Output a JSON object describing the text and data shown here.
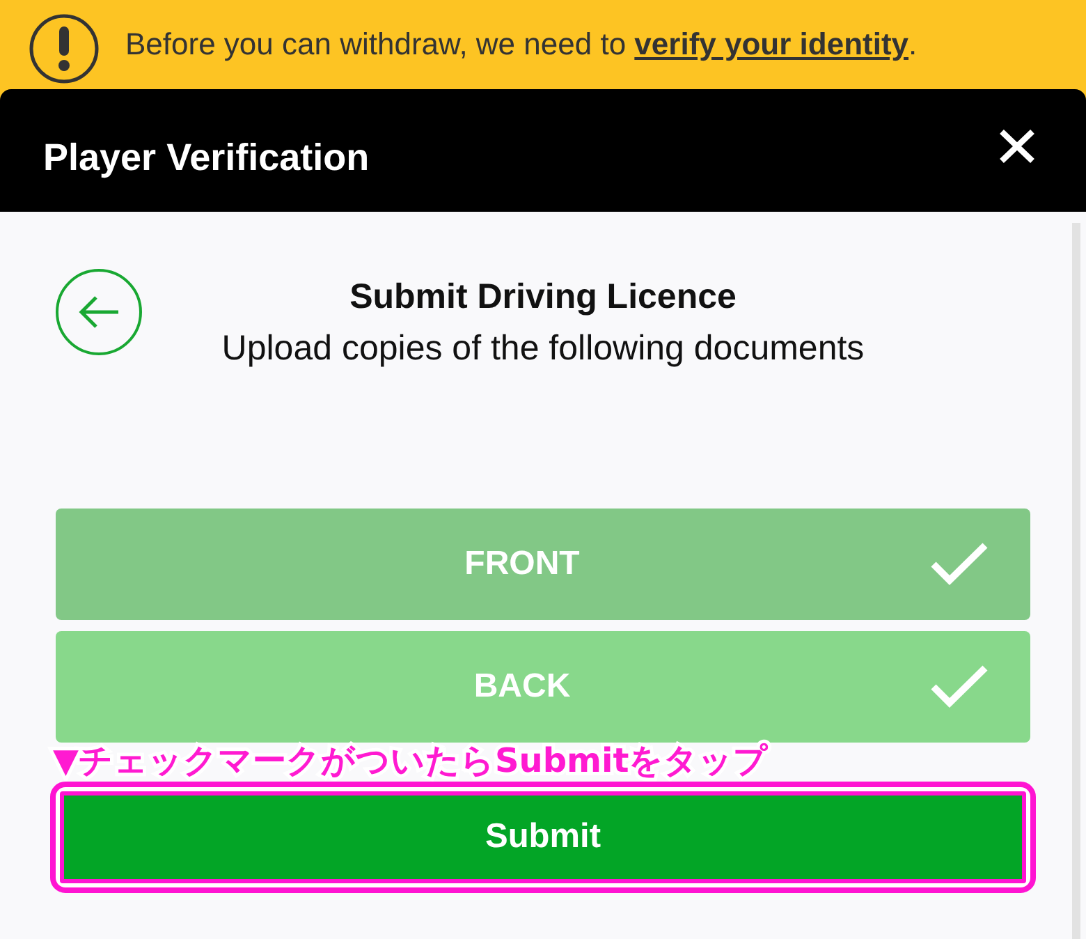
{
  "banner": {
    "message_start": "Before you can withdraw, we need to ",
    "link": "verify your identity",
    "message_end": "."
  },
  "dialog": {
    "title": "Player Verification"
  },
  "step": {
    "title": "Submit Driving Licence",
    "subtitle": "Upload copies of the following documents"
  },
  "documents": [
    {
      "label": "FRONT",
      "uploaded": true,
      "color": "#82c886"
    },
    {
      "label": "BACK",
      "uploaded": true,
      "color": "#88d88b"
    }
  ],
  "annotation": "▼チェックマークがついたらSubmitをタップ",
  "submit": {
    "label": "Submit"
  }
}
